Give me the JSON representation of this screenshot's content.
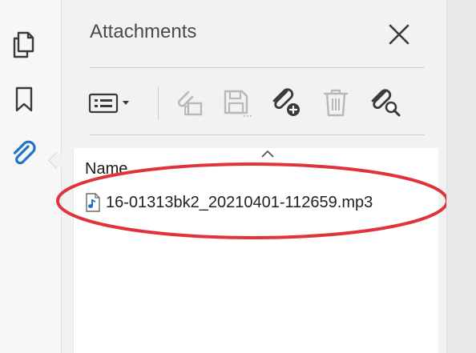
{
  "rail": {
    "items": [
      {
        "icon": "pages-icon"
      },
      {
        "icon": "bookmark-icon"
      },
      {
        "icon": "paperclip-icon",
        "active": true
      }
    ]
  },
  "panel": {
    "title": "Attachments",
    "toolbar": {
      "buttons": [
        "options-menu",
        "open-attachment",
        "save-attachment",
        "add-attachment",
        "delete-attachment",
        "search-attachment"
      ]
    },
    "list": {
      "column_name": "Name",
      "sort_indicator": "^",
      "items": [
        {
          "name": "16-01313bk2_20210401-112659.mp3",
          "icon": "audio-file-icon"
        }
      ]
    }
  },
  "colors": {
    "accent": "#1f73c9",
    "annotation": "#e0343c",
    "icon": "#3a3a3a",
    "disabled": "#b8b8b8"
  }
}
